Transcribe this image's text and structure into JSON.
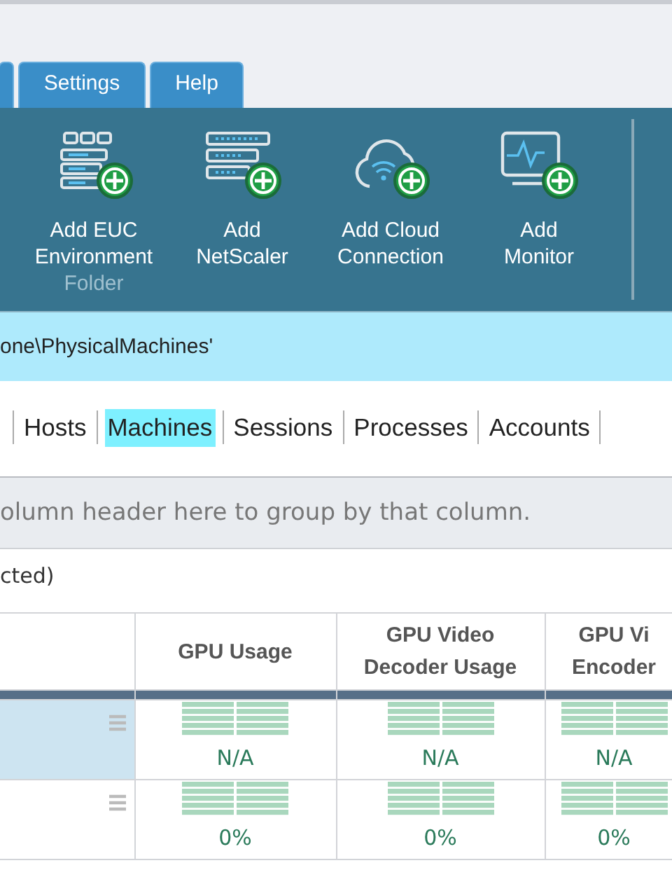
{
  "menu_tabs": [
    {
      "selected": false
    },
    {
      "label": "Settings",
      "selected": false
    },
    {
      "label": "Help",
      "selected": false
    }
  ],
  "ribbon": {
    "buttons": [
      {
        "kind": "euc",
        "label": "Add EUC Environment",
        "sublabel": "Folder"
      },
      {
        "kind": "netscaler",
        "label": "Add NetScaler"
      },
      {
        "kind": "cloud",
        "label": "Add Cloud Connection"
      },
      {
        "kind": "monitor",
        "label": "Add Monitor"
      }
    ]
  },
  "path_bar": {
    "text": "one\\PhysicalMachines'"
  },
  "view_tabs": [
    {
      "label": "Hosts",
      "selected": false
    },
    {
      "label": "Machines",
      "selected": true
    },
    {
      "label": "Sessions",
      "selected": false
    },
    {
      "label": "Processes",
      "selected": false
    },
    {
      "label": "Accounts",
      "selected": false
    }
  ],
  "group_bar": {
    "text": "olumn header here to group by that column."
  },
  "selection_note": "cted)",
  "table": {
    "columns": [
      "",
      "GPU Usage",
      "GPU Video Decoder Usage",
      "GPU Vi Encoder"
    ],
    "rows": [
      {
        "selected": true,
        "cells": [
          "",
          "N/A",
          "N/A",
          "N/A"
        ]
      },
      {
        "selected": false,
        "cells": [
          "",
          "0%",
          "0%",
          "0%"
        ]
      }
    ]
  }
}
